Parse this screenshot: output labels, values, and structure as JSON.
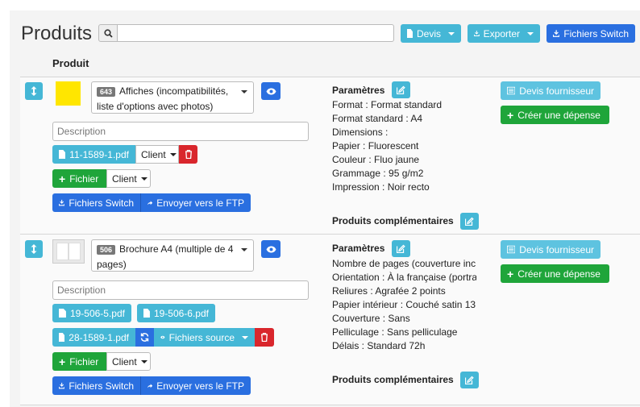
{
  "header": {
    "title": "Produits",
    "search_placeholder": "",
    "devis_label": "Devis",
    "exporter_label": "Exporter",
    "fichiers_switch_label": "Fichiers Switch"
  },
  "table": {
    "column_produit": "Produit"
  },
  "rows": [
    {
      "product_badge": "643",
      "product_name": "Affiches (incompatibilités, liste d'options avec photos)",
      "thumb_color": "#ffe600",
      "description_placeholder": "Description",
      "files": [
        "11-1589-1.pdf"
      ],
      "client_label": "Client",
      "fichier_label": "Fichier",
      "fichier_client_label": "Client",
      "fichiers_switch_label": "Fichiers Switch",
      "ftp_label": "Envoyer vers le FTP",
      "params_title": "Paramètres",
      "params": [
        "Format : Format standard",
        "Format standard : A4",
        "Dimensions :",
        "Papier : Fluorescent",
        "Couleur : Fluo jaune",
        "Grammage : 95 g/m2",
        "Impression : Noir recto"
      ],
      "complementary_title": "Produits complémentaires",
      "devis_fournisseur_label": "Devis fournisseur",
      "creer_depense_label": "Créer une dépense"
    },
    {
      "product_badge": "506",
      "product_name": "Brochure A4 (multiple de 4 pages)",
      "description_placeholder": "Description",
      "files": [
        "19-506-5.pdf",
        "19-506-6.pdf",
        "28-1589-1.pdf"
      ],
      "fichiers_source_label": "Fichiers source",
      "fichier_label": "Fichier",
      "fichier_client_label": "Client",
      "fichiers_switch_label": "Fichiers Switch",
      "ftp_label": "Envoyer vers le FTP",
      "params_title": "Paramètres",
      "params": [
        "Nombre de pages (couverture inc",
        "Orientation : À la française (portra",
        "Reliures : Agrafée 2 points",
        "Papier intérieur : Couché satin 13",
        "Couverture : Sans",
        "Pelliculage : Sans pelliculage",
        "Délais : Standard 72h"
      ],
      "complementary_title": "Produits complémentaires",
      "devis_fournisseur_label": "Devis fournisseur",
      "creer_depense_label": "Créer une dépense"
    }
  ],
  "colors": {
    "teal": "#45b7d6",
    "blue": "#2a6fe0",
    "green": "#1fa53a",
    "red": "#d9262c"
  }
}
